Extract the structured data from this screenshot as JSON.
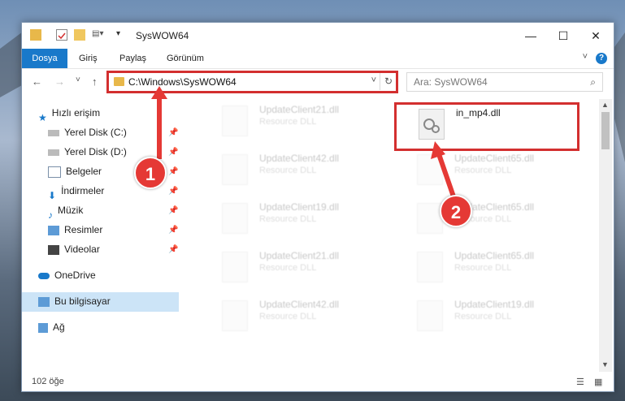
{
  "window": {
    "title": "SysWOW64",
    "controls": [
      "—",
      "☐",
      "✕"
    ]
  },
  "ribbon": {
    "tabs": [
      "Dosya",
      "Giriş",
      "Paylaş",
      "Görünüm"
    ],
    "help": "?"
  },
  "nav": {
    "back": "←",
    "forward": "→",
    "recent": "˅",
    "up": "↑",
    "address": "C:\\Windows\\SysWOW64",
    "refresh": "↻",
    "search_placeholder": "Ara: SysWOW64"
  },
  "sidebar": {
    "quick_access": "Hızlı erişim",
    "items": [
      {
        "label": "Yerel Disk (C:)",
        "icon": "drive-icon"
      },
      {
        "label": "Yerel Disk (D:)",
        "icon": "drive-icon"
      },
      {
        "label": "Belgeler",
        "icon": "documents-icon"
      },
      {
        "label": "İndirmeler",
        "icon": "downloads-icon"
      },
      {
        "label": "Müzik",
        "icon": "music-icon"
      },
      {
        "label": "Resimler",
        "icon": "pictures-icon"
      },
      {
        "label": "Videolar",
        "icon": "videos-icon"
      }
    ],
    "onedrive": "OneDrive",
    "this_pc": "Bu bilgisayar",
    "network": "Ağ"
  },
  "files": {
    "highlighted": {
      "name": "in_mp4.dll",
      "type": ""
    },
    "faded": [
      {
        "name": "UpdateClient21.dll",
        "type": "Resource DLL"
      },
      {
        "name": "UpdateClient42.dll",
        "type": "Resource DLL"
      },
      {
        "name": "UpdateClient65.dll",
        "type": "Resource DLL"
      },
      {
        "name": "UpdateClient19.dll",
        "type": "Resource DLL"
      },
      {
        "name": "UpdateClient65.dll",
        "type": "Resource DLL"
      },
      {
        "name": "UpdateClient21.dll",
        "type": "Resource DLL"
      },
      {
        "name": "UpdateClient65.dll",
        "type": "Resource DLL"
      },
      {
        "name": "UpdateClient42.dll",
        "type": "Resource DLL"
      },
      {
        "name": "UpdateClient19.dll",
        "type": "Resource DLL"
      }
    ]
  },
  "status": {
    "count": "102 öğe"
  },
  "callouts": [
    "1",
    "2"
  ],
  "colors": {
    "accent": "#1979ca",
    "highlight": "#d32f2f",
    "callout": "#e53935"
  }
}
